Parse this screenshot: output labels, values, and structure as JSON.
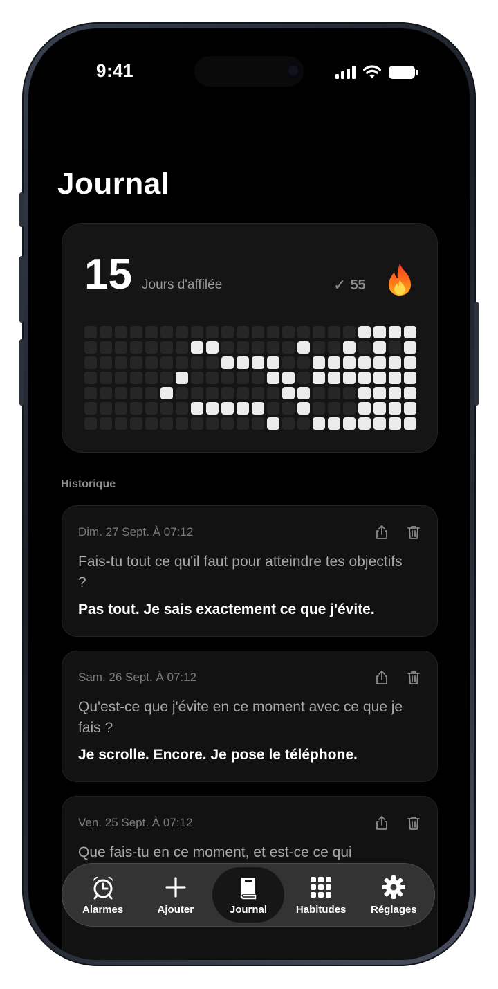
{
  "status_bar": {
    "time": "9:41"
  },
  "page": {
    "title": "Journal"
  },
  "streak": {
    "days": "15",
    "days_label": "Jours d'affilée",
    "check_count": "55",
    "icons": [
      "check-icon",
      "fire-icon"
    ]
  },
  "activity_grid": {
    "columns": 22,
    "rows": 7,
    "active_cells": [
      [
        0,
        18
      ],
      [
        0,
        19
      ],
      [
        0,
        20
      ],
      [
        0,
        21
      ],
      [
        1,
        7
      ],
      [
        1,
        8
      ],
      [
        1,
        14
      ],
      [
        1,
        17
      ],
      [
        1,
        19
      ],
      [
        1,
        21
      ],
      [
        2,
        9
      ],
      [
        2,
        10
      ],
      [
        2,
        11
      ],
      [
        2,
        12
      ],
      [
        2,
        15
      ],
      [
        2,
        16
      ],
      [
        2,
        17
      ],
      [
        2,
        18
      ],
      [
        2,
        19
      ],
      [
        2,
        20
      ],
      [
        2,
        21
      ],
      [
        3,
        6
      ],
      [
        3,
        12
      ],
      [
        3,
        13
      ],
      [
        3,
        15
      ],
      [
        3,
        16
      ],
      [
        3,
        17
      ],
      [
        3,
        18
      ],
      [
        3,
        19
      ],
      [
        3,
        20
      ],
      [
        3,
        21
      ],
      [
        4,
        5
      ],
      [
        4,
        13
      ],
      [
        4,
        14
      ],
      [
        4,
        18
      ],
      [
        4,
        19
      ],
      [
        4,
        20
      ],
      [
        4,
        21
      ],
      [
        5,
        7
      ],
      [
        5,
        8
      ],
      [
        5,
        9
      ],
      [
        5,
        10
      ],
      [
        5,
        11
      ],
      [
        5,
        14
      ],
      [
        5,
        18
      ],
      [
        5,
        19
      ],
      [
        5,
        20
      ],
      [
        5,
        21
      ],
      [
        6,
        12
      ],
      [
        6,
        15
      ],
      [
        6,
        16
      ],
      [
        6,
        17
      ],
      [
        6,
        18
      ],
      [
        6,
        19
      ],
      [
        6,
        20
      ],
      [
        6,
        21
      ]
    ]
  },
  "history": {
    "label": "Historique",
    "entries": [
      {
        "date": "Dim. 27 Sept. À 07:12",
        "question": "Fais-tu tout ce qu'il faut pour atteindre tes objectifs ?",
        "answer": "Pas tout. Je sais exactement ce que j'évite."
      },
      {
        "date": "Sam. 26 Sept. À 07:12",
        "question": "Qu'est-ce que j'évite en ce moment avec ce que je fais ?",
        "answer": "Je scrolle. Encore. Je pose le téléphone."
      },
      {
        "date": "Ven. 25 Sept. À 07:12",
        "question": "Que fais-tu en ce moment, et est-ce ce qui",
        "answer": ""
      }
    ],
    "action_icons": [
      "share-icon",
      "trash-icon"
    ]
  },
  "tabbar": {
    "tabs": [
      {
        "label": "Alarmes",
        "icon": "alarm-clock-icon",
        "active": false
      },
      {
        "label": "Ajouter",
        "icon": "plus-icon",
        "active": false
      },
      {
        "label": "Journal",
        "icon": "book-icon",
        "active": true
      },
      {
        "label": "Habitudes",
        "icon": "grid-icon",
        "active": false
      },
      {
        "label": "Réglages",
        "icon": "gear-icon",
        "active": false
      }
    ]
  },
  "colors": {
    "background": "#000000",
    "card": "#151515",
    "active_cell": "#ececec",
    "inactive_cell": "#262626"
  }
}
